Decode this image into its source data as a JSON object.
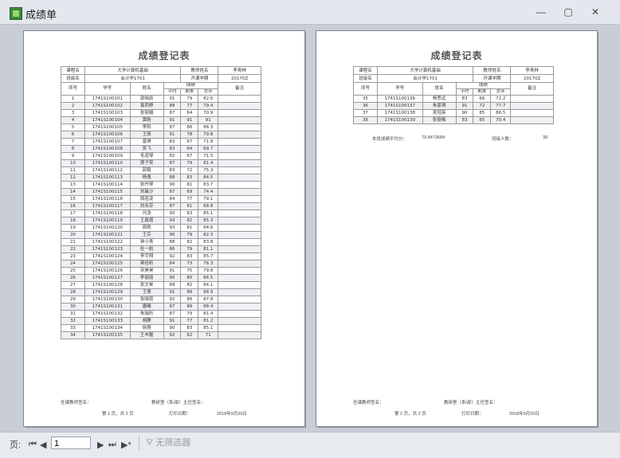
{
  "window": {
    "title": "成绩单",
    "min": "—",
    "max": "▢",
    "close": "✕"
  },
  "report": {
    "title": "成绩登记表",
    "header": {
      "course_label": "课程名",
      "course": "大学计算机基础",
      "teacher_label": "教师姓名",
      "teacher": "李青林",
      "class_label": "班级名",
      "class": "会计学1701",
      "term_label": "开课学期",
      "term": "20170Z"
    },
    "columns": {
      "seq": "序号",
      "id": "学号",
      "name": "姓名",
      "grade": "成绩",
      "usual": "平时",
      "final": "期末",
      "total": "总评",
      "note": "备注"
    },
    "page1_rows": [
      [
        "1",
        "1741S100101",
        "郭晓辰",
        "91",
        "79",
        "82.6"
      ],
      [
        "2",
        "1741S100102",
        "袁莉婷",
        "88",
        "77",
        "79.4"
      ],
      [
        "3",
        "1741S100103",
        "张丽娟",
        "87",
        "64",
        "70.9"
      ],
      [
        "4",
        "1741S100104",
        "黄皓",
        "91",
        "91",
        "91"
      ],
      [
        "5",
        "1741S100105",
        "李阳",
        "87",
        "86",
        "86.3"
      ],
      [
        "6",
        "1741S100106",
        "王辰",
        "91",
        "78",
        "79.8"
      ],
      [
        "7",
        "1741S100107",
        "曾琪",
        "83",
        "67",
        "71.8"
      ],
      [
        "8",
        "1741S100108",
        "吴飞",
        "83",
        "64",
        "69.7"
      ],
      [
        "9",
        "1741S100109",
        "毛道琴",
        "82",
        "67",
        "71.5"
      ],
      [
        "10",
        "1741S100110",
        "席子奕",
        "87",
        "79",
        "81.4"
      ],
      [
        "11",
        "1741S100112",
        "郭毅",
        "83",
        "72",
        "75.3"
      ],
      [
        "12",
        "1741S100113",
        "杨逸",
        "88",
        "83",
        "84.5"
      ],
      [
        "13",
        "1741S100114",
        "张丹琴",
        "90",
        "81",
        "83.7"
      ],
      [
        "14",
        "1741S100115",
        "刘晨沙",
        "87",
        "69",
        "74.4"
      ],
      [
        "15",
        "1741S100116",
        "周若凌",
        "84",
        "77",
        "79.1"
      ],
      [
        "16",
        "1741S100117",
        "刘永芬",
        "87",
        "61",
        "68.8"
      ],
      [
        "17",
        "1741S100118",
        "冯浩",
        "90",
        "83",
        "85.1"
      ],
      [
        "18",
        "1741S100119",
        "王鑫煜",
        "93",
        "82",
        "85.3"
      ],
      [
        "19",
        "1741S100120",
        "周艳",
        "93",
        "81",
        "84.6"
      ],
      [
        "20",
        "1741S100121",
        "王芬",
        "90",
        "79",
        "82.3"
      ],
      [
        "21",
        "1741S100122",
        "钟小青",
        "88",
        "82",
        "83.8"
      ],
      [
        "22",
        "1741S100123",
        "杜一航",
        "86",
        "79",
        "81.1"
      ],
      [
        "23",
        "1741S100124",
        "李宇翔",
        "92",
        "83",
        "85.7"
      ],
      [
        "24",
        "1741S100125",
        "蒋佳昕",
        "84",
        "73",
        "76.3"
      ],
      [
        "25",
        "1741S100126",
        "宋昊昊",
        "91",
        "75",
        "79.8"
      ],
      [
        "26",
        "1741S100127",
        "李丽丽",
        "90",
        "85",
        "86.5"
      ],
      [
        "27",
        "1741S100128",
        "张文昊",
        "89",
        "82",
        "84.1"
      ],
      [
        "28",
        "1741S100129",
        "王璟",
        "91",
        "88",
        "88.9"
      ],
      [
        "29",
        "1741S100130",
        "张晓雨",
        "92",
        "86",
        "87.8"
      ],
      [
        "30",
        "1741S100131",
        "唐曦",
        "87",
        "89",
        "88.4"
      ],
      [
        "31",
        "1741S100132",
        "朱瑞珩",
        "87",
        "79",
        "81.4"
      ],
      [
        "32",
        "1741S100133",
        "胡静",
        "91",
        "77",
        "81.2"
      ],
      [
        "33",
        "1741S100134",
        "徐燕",
        "90",
        "83",
        "85.1"
      ],
      [
        "34",
        "1741S100135",
        "王丰磊",
        "92",
        "62",
        "71"
      ]
    ],
    "page2_rows": [
      [
        "35",
        "1741S100136",
        "杨思远",
        "83",
        "66",
        "72.2"
      ],
      [
        "36",
        "1741S100137",
        "朱家琪",
        "91",
        "72",
        "77.7"
      ],
      [
        "37",
        "1741S100138",
        "吴冠英",
        "90",
        "85",
        "86.5"
      ],
      [
        "38",
        "1741S100139",
        "张丽梅",
        "83",
        "65",
        "70.4"
      ]
    ],
    "summary_avg_label": "本班成绩平均分：",
    "summary_avg": "79.8473684",
    "summary_count_label": "班级人数：",
    "summary_count": "38",
    "sign_teacher": "任课教师签名：",
    "sign_dept": "教研室（系/部）主任签名：",
    "page1_footer": "第 1 页，共 2 页",
    "page2_footer": "第 2 页，共 2 页",
    "print_date_label": "打印日期：",
    "print_date": "2018年9月20日"
  },
  "statusbar": {
    "page_label": "页:",
    "page_value": "1",
    "filter": "无筛选器"
  }
}
